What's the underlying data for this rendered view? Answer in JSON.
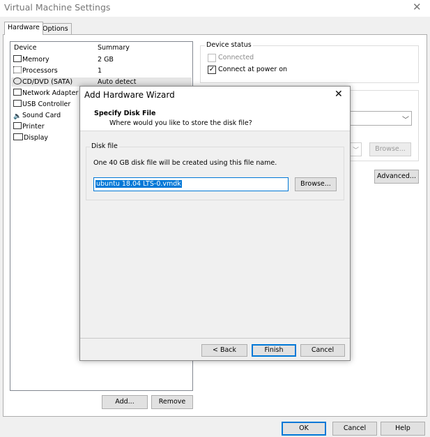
{
  "window": {
    "title": "Virtual Machine Settings",
    "close_icon": "close-icon"
  },
  "tabs": [
    {
      "label": "Hardware",
      "active": true
    },
    {
      "label": "Options",
      "active": false
    }
  ],
  "device_list": {
    "headers": {
      "device": "Device",
      "summary": "Summary"
    },
    "devices": [
      {
        "name": "Memory",
        "summary": "2 GB",
        "icon": "memory-icon",
        "selected": false
      },
      {
        "name": "Processors",
        "summary": "1",
        "icon": "processor-icon",
        "selected": false
      },
      {
        "name": "CD/DVD (SATA)",
        "summary": "Auto detect",
        "icon": "cd-dvd-icon",
        "selected": true
      },
      {
        "name": "Network Adapter",
        "summary": "",
        "icon": "network-adapter-icon",
        "selected": false
      },
      {
        "name": "USB Controller",
        "summary": "",
        "icon": "usb-icon",
        "selected": false
      },
      {
        "name": "Sound Card",
        "summary": "",
        "icon": "speaker-icon",
        "selected": false
      },
      {
        "name": "Printer",
        "summary": "",
        "icon": "printer-icon",
        "selected": false
      },
      {
        "name": "Display",
        "summary": "",
        "icon": "display-icon",
        "selected": false
      }
    ]
  },
  "list_buttons": {
    "add": "Add...",
    "remove": "Remove"
  },
  "device_status": {
    "legend": "Device status",
    "connected": {
      "label": "Connected",
      "checked": false,
      "disabled": true
    },
    "connect_at_power_on": {
      "label": "Connect at power on",
      "checked": true
    }
  },
  "connection": {
    "browse": "Browse...",
    "advanced": "Advanced..."
  },
  "wizard": {
    "title": "Add Hardware Wizard",
    "heading": "Specify Disk File",
    "subheading": "Where would you like to store the disk file?",
    "disk_file_legend": "Disk file",
    "description": "One 40 GB disk file will be created using this file name.",
    "file_name": "ubuntu 18.04 LTS-0.vmdk",
    "browse": "Browse...",
    "back": "< Back",
    "finish": "Finish",
    "cancel": "Cancel"
  },
  "footer": {
    "ok": "OK",
    "cancel": "Cancel",
    "help": "Help"
  }
}
